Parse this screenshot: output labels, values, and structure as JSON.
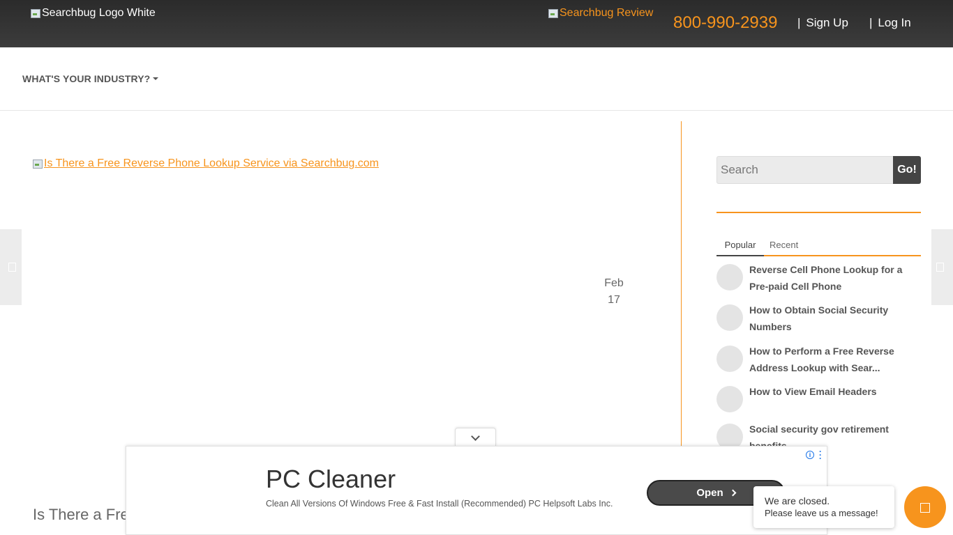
{
  "header": {
    "logo_alt": "Searchbug Logo White",
    "review_alt": "Searchbug Review",
    "phone": "800-990-2939",
    "separator": "|",
    "signup": "Sign Up",
    "login": "Log In"
  },
  "nav": {
    "industry": "WHAT'S YOUR INDUSTRY?"
  },
  "post": {
    "image_alt": "Is There a Free Reverse Phone Lookup Service via Searchbug.com",
    "date_month": "Feb",
    "date_day": "17",
    "title_partial": "Is There a Free"
  },
  "sidebar": {
    "search_placeholder": "Search",
    "go_label": "Go!",
    "tabs": [
      {
        "label": "Popular",
        "active": true
      },
      {
        "label": "Recent",
        "active": false
      }
    ],
    "posts": [
      {
        "title": "Reverse Cell Phone Lookup for a Pre-paid Cell Phone"
      },
      {
        "title": "How to Obtain Social Security Numbers"
      },
      {
        "title": "How to Perform a Free Reverse Address Lookup with Sear..."
      },
      {
        "title": "How to View Email Headers"
      },
      {
        "title": "Social security gov retirement benefits"
      }
    ]
  },
  "ad": {
    "title": "PC Cleaner",
    "description": "Clean All Versions Of Windows Free & Fast Install (Recommended) PC Helpsoft Labs Inc.",
    "cta": "Open"
  },
  "chat": {
    "line1": "We are closed.",
    "line2": "Please leave us a message!"
  },
  "colors": {
    "accent": "#f7941d",
    "topbar": "#333333"
  }
}
